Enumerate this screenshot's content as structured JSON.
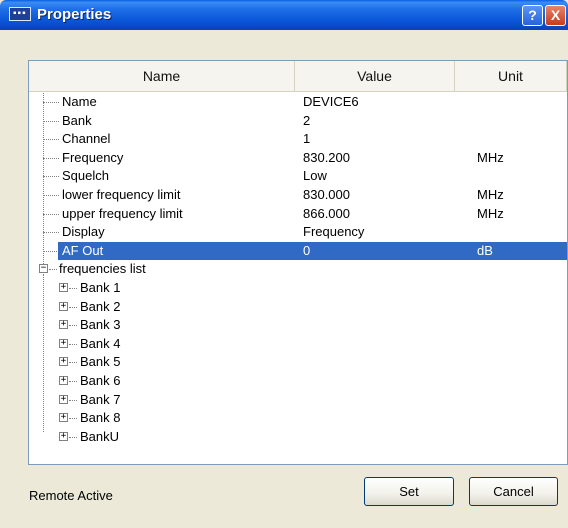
{
  "window": {
    "title": "Properties"
  },
  "title_buttons": {
    "help": "?",
    "close": "X"
  },
  "columns": {
    "name": "Name",
    "value": "Value",
    "unit": "Unit"
  },
  "properties": [
    {
      "name": "Name",
      "value": "DEVICE6",
      "unit": ""
    },
    {
      "name": "Bank",
      "value": "2",
      "unit": ""
    },
    {
      "name": "Channel",
      "value": "1",
      "unit": ""
    },
    {
      "name": "Frequency",
      "value": "830.200",
      "unit": "MHz"
    },
    {
      "name": "Squelch",
      "value": "Low",
      "unit": ""
    },
    {
      "name": "lower frequency limit",
      "value": "830.000",
      "unit": "MHz"
    },
    {
      "name": "upper frequency limit",
      "value": "866.000",
      "unit": "MHz"
    },
    {
      "name": "Display",
      "value": "Frequency",
      "unit": ""
    },
    {
      "name": "AF Out",
      "value": "0",
      "unit": "dB",
      "selected": true
    }
  ],
  "frequencies_list": {
    "label": "frequencies list",
    "expander": "−",
    "child_expander": "+",
    "banks": [
      "Bank 1",
      "Bank 2",
      "Bank 3",
      "Bank 4",
      "Bank 5",
      "Bank 6",
      "Bank 7",
      "Bank 8",
      "BankU"
    ]
  },
  "status": {
    "text": "Remote Active"
  },
  "buttons": {
    "set": "Set",
    "cancel": "Cancel"
  },
  "colors": {
    "selection": "#316AC5",
    "titlebar": "#0A55D8",
    "dialog_bg": "#ECE9D8"
  }
}
